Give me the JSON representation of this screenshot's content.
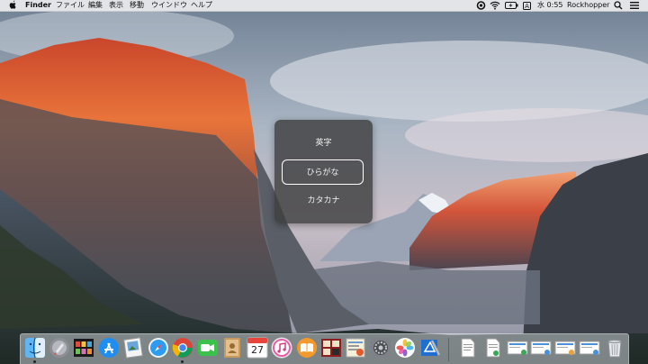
{
  "menubar": {
    "app_name": "Finder",
    "menus": [
      "ファイル",
      "編集",
      "表示",
      "移動",
      "ウインドウ",
      "ヘルプ"
    ],
    "status": {
      "ime_indicator": "A",
      "clock": "水 0:55",
      "user": "Rockhopper"
    },
    "icons": [
      "apple-icon",
      "creative-cloud-icon",
      "wifi-icon",
      "battery-icon",
      "search-icon",
      "menu-list-icon"
    ]
  },
  "ime_popup": {
    "items": [
      "英字",
      "ひらがな",
      "カタカナ"
    ],
    "selected": "ひらがな"
  },
  "dock": {
    "apps": [
      "finder-icon",
      "launchpad-icon",
      "photo-booth-icon",
      "app-store-icon",
      "preview-icon",
      "safari-icon",
      "chrome-icon",
      "facetime-icon",
      "contacts-icon",
      "calendar-icon",
      "itunes-icon",
      "ibooks-icon",
      "photo-booth-2-icon",
      "notes-icon",
      "system-preferences-icon",
      "photos-icon",
      "xcode-icon"
    ],
    "calendar_day": "27",
    "documents": [
      "document-1-icon",
      "document-2-icon",
      "screenshot-1-icon",
      "screenshot-2-icon",
      "screenshot-3-icon",
      "screenshot-4-icon"
    ],
    "trash": "trash-icon"
  }
}
